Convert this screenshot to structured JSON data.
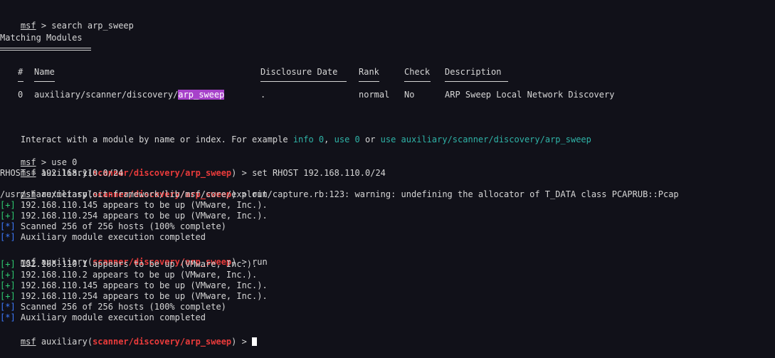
{
  "prompt": "msf",
  "prompt_sep": " > ",
  "lines": {
    "search_cmd": "search arp_sweep",
    "matching_title": "Matching Modules",
    "headers": {
      "num": "#",
      "name": "Name",
      "date": "Disclosure Date",
      "rank": "Rank",
      "check": "Check",
      "desc": "Description"
    },
    "row": {
      "num": "0",
      "name_prefix": "auxiliary/scanner/discovery/",
      "name_hl": "arp_sweep",
      "date": ".",
      "rank": "normal",
      "check": "No",
      "desc": "ARP Sweep Local Network Discovery"
    },
    "interact": {
      "prefix": "Interact with a module by name or index. For example ",
      "ex1": "info 0",
      "comma": ", ",
      "ex2": "use 0",
      "or": " or ",
      "ex3": "use auxiliary/scanner/discovery/arp_sweep"
    },
    "use_cmd": "use 0",
    "aux_prefix": "auxiliary(",
    "module_path": "scanner/discovery/arp_sweep",
    "aux_suffix": ") > ",
    "set_cmd": "set RHOST 192.168.110.0/24",
    "rhost_out": "RHOST ⇒ 192.168.110.0/24",
    "run_cmd": "run",
    "warning": "/usr/share/metasploit-framework/lib/msf/core/exploit/capture.rb:123: warning: undefining the allocator of T_DATA class PCAPRUB::Pcap",
    "plus_tag": "[+]",
    "star_tag": "[*]",
    "run1": [
      {
        "tag": "plus",
        "text": " 192.168.110.145 appears to be up (VMware, Inc.)."
      },
      {
        "tag": "plus",
        "text": " 192.168.110.254 appears to be up (VMware, Inc.)."
      },
      {
        "tag": "star",
        "text": " Scanned 256 of 256 hosts (100% complete)"
      },
      {
        "tag": "star",
        "text": " Auxiliary module execution completed"
      }
    ],
    "run2": [
      {
        "tag": "plus",
        "text": " 192.168.110.1 appears to be up (VMware, Inc.)."
      },
      {
        "tag": "plus",
        "text": " 192.168.110.2 appears to be up (VMware, Inc.)."
      },
      {
        "tag": "plus",
        "text": " 192.168.110.145 appears to be up (VMware, Inc.)."
      },
      {
        "tag": "plus",
        "text": " 192.168.110.254 appears to be up (VMware, Inc.)."
      },
      {
        "tag": "star",
        "text": " Scanned 256 of 256 hosts (100% complete)"
      },
      {
        "tag": "star",
        "text": " Auxiliary module execution completed"
      }
    ]
  },
  "colors": {
    "background": "#111119",
    "text": "#d6d6d6",
    "module_red": "#ea3b3b",
    "plus_green": "#2ecc71",
    "star_blue": "#3d7bff",
    "example_teal": "#2fb3a7",
    "highlight_purple": "#a742ca"
  }
}
